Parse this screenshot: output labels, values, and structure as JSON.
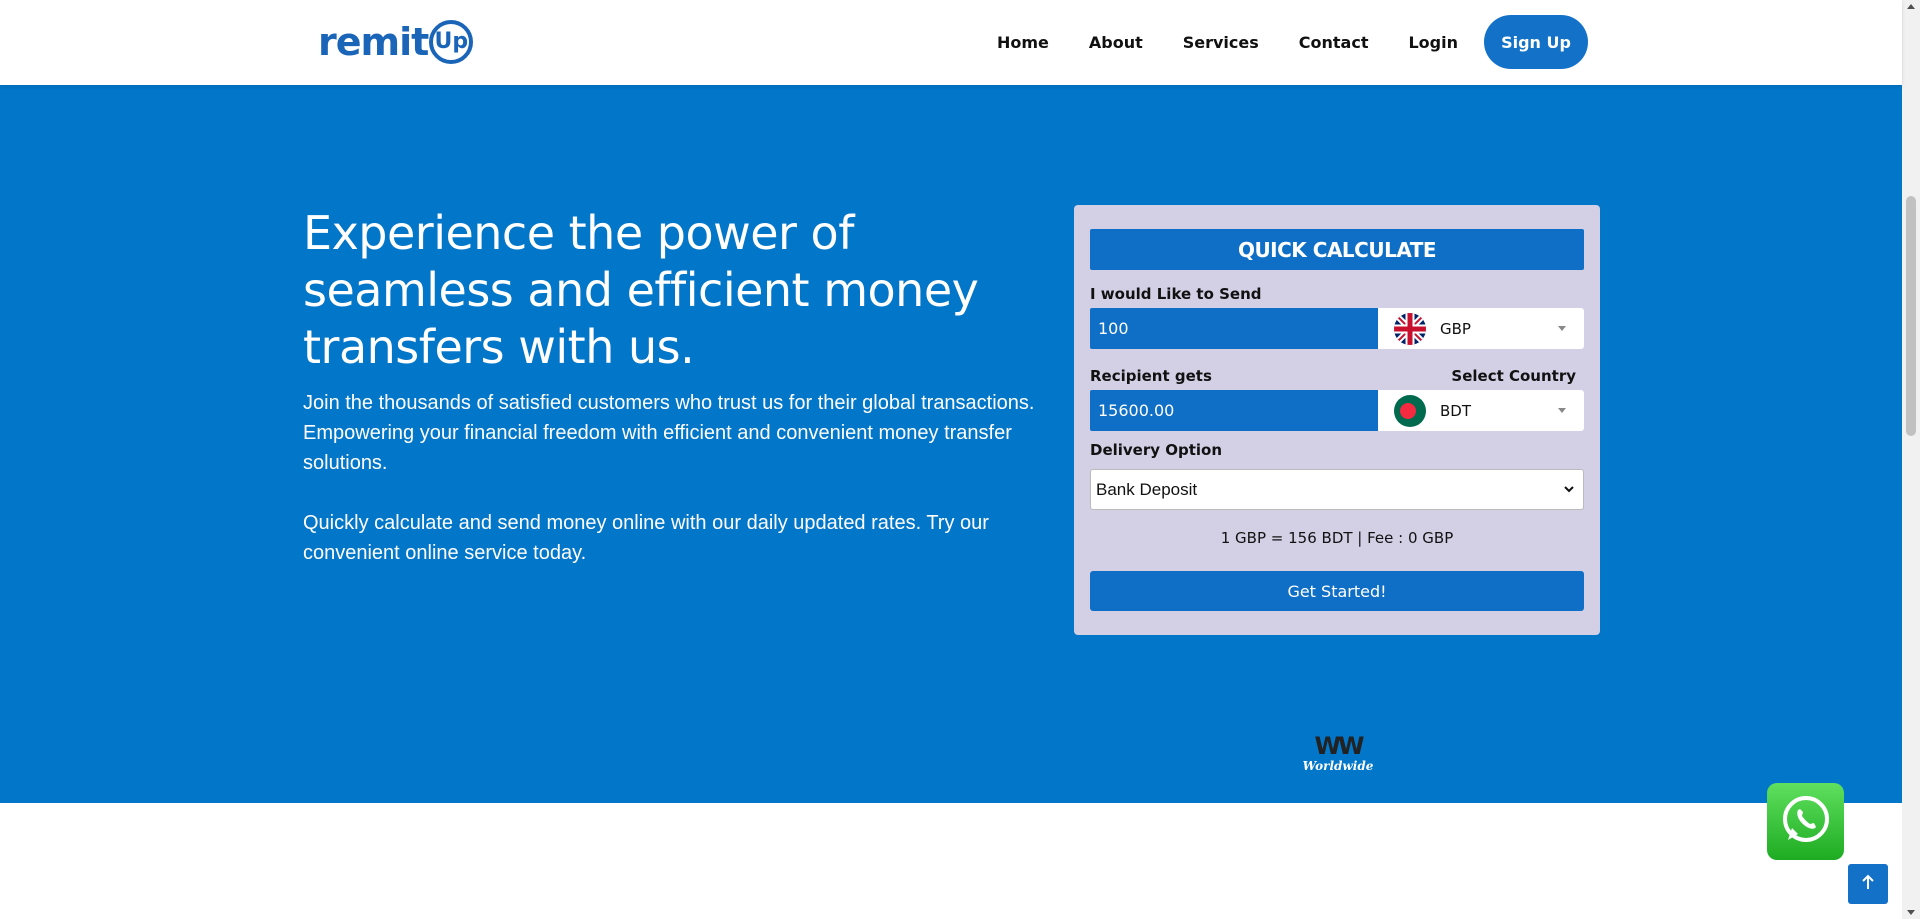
{
  "header": {
    "logo_text": "remit",
    "logo_up": "Up",
    "nav": [
      "Home",
      "About",
      "Services",
      "Contact",
      "Login"
    ],
    "signup_label": "Sign Up"
  },
  "hero": {
    "headline": "Experience the power of seamless and efficient money transfers with us.",
    "paragraph1": "Join the thousands of satisfied customers who trust us for their global transactions. Empowering your financial freedom with efficient and convenient money transfer solutions.",
    "paragraph2": "Quickly calculate and send money online with our daily updated rates. Try our convenient online service today."
  },
  "calculator": {
    "title": "QUICK CALCULATE",
    "send_label": "I would Like to Send",
    "send_amount": "100",
    "send_currency": "GBP",
    "recipient_label": "Recipient gets",
    "select_country_label": "Select Country",
    "recipient_amount": "15600.00",
    "recipient_currency": "BDT",
    "delivery_label": "Delivery Option",
    "delivery_value": "Bank Deposit",
    "rate_text": "1 GBP = 156 BDT | Fee : 0 GBP",
    "cta_label": "Get Started!"
  },
  "badge": {
    "mark": "WW",
    "text": "Worldwide"
  },
  "icons": {
    "whatsapp": "whatsapp-icon",
    "to_top": "arrow-up-icon",
    "uk_flag": "uk-flag-icon",
    "bd_flag": "bangladesh-flag-icon"
  },
  "colors": {
    "hero_bg": "#0276c8",
    "primary": "#0f6fc7",
    "card_bg": "#d3d0e6",
    "whatsapp": "#25d366"
  }
}
